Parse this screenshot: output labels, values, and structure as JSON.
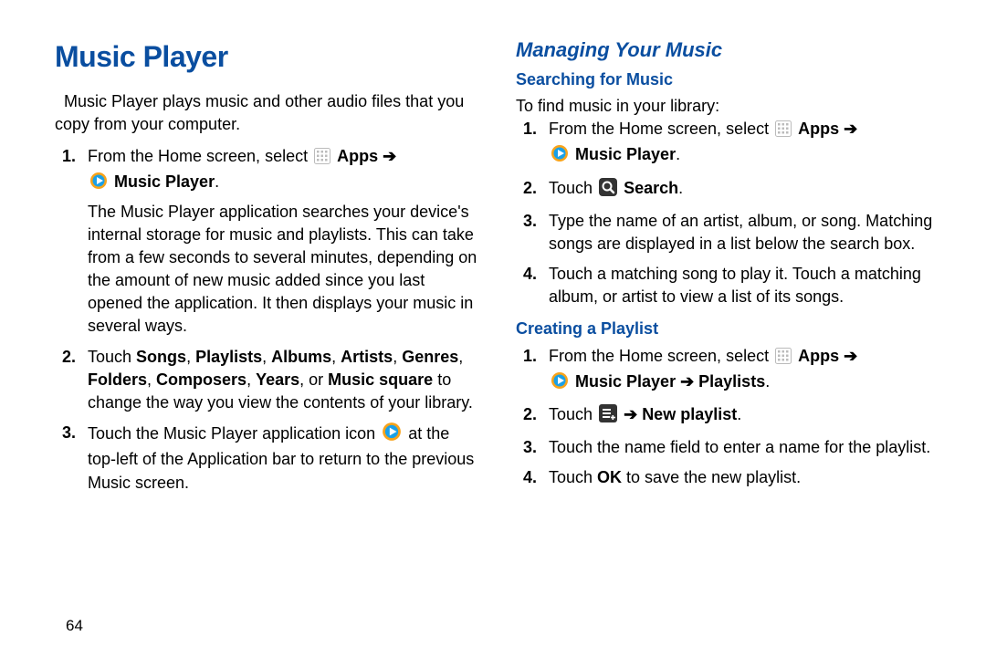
{
  "pageNumber": "64",
  "left": {
    "title": "Music Player",
    "intro": "Music Player plays music and other audio files that you copy from your computer.",
    "s1_a": "From the Home screen, select",
    "s1_apps": "Apps",
    "s1_arrow": "➔",
    "s1_mp": "Music Player",
    "s1_dot": ".",
    "s1_desc": "The Music Player application searches your device's internal storage for music and playlists. This can take from a few seconds to several minutes, depending on the amount of new music added since you last opened the application. It then displays your music in several ways.",
    "s2_a": "Touch ",
    "s2_songs": "Songs",
    "s2_c1": ", ",
    "s2_playlists": "Playlists",
    "s2_c2": ", ",
    "s2_albums": "Albums",
    "s2_c3": ", ",
    "s2_artists": "Artists",
    "s2_c4": ", ",
    "s2_genres": "Genres",
    "s2_c5": ", ",
    "s2_folders": "Folders",
    "s2_c6": ", ",
    "s2_composers": "Composers",
    "s2_c7": ", ",
    "s2_years": "Years",
    "s2_c8": ", or ",
    "s2_msquare": "Music square",
    "s2_b": " to change the way you view the contents of your library.",
    "s3_a": "Touch the Music Player application icon",
    "s3_b": "at the top-left of the Application bar to return to the previous Music screen."
  },
  "right": {
    "h2": "Managing Your Music",
    "h3a": "Searching for Music",
    "introA": "To find music in your library:",
    "a1_a": "From the Home screen, select",
    "a1_apps": "Apps",
    "a1_arrow": "➔",
    "a1_mp": "Music Player",
    "a1_dot": ".",
    "a2_a": "Touch",
    "a2_search": "Search",
    "a2_dot": ".",
    "a3": "Type the name of an artist, album, or song. Matching songs are displayed in a list below the search box.",
    "a4": "Touch a matching song to play it. Touch a matching album, or artist to view a list of its songs.",
    "h3b": "Creating a Playlist",
    "b1_a": "From the Home screen, select",
    "b1_apps": "Apps",
    "b1_arrow": "➔",
    "b1_mp": "Music Player ➔ Playlists",
    "b1_dot": ".",
    "b2_a": "Touch",
    "b2_arrow": "➔",
    "b2_np": "New playlist",
    "b2_dot": ".",
    "b3": "Touch the name field to enter a name for the playlist.",
    "b4_a": "Touch ",
    "b4_ok": "OK",
    "b4_b": " to save the new playlist."
  }
}
